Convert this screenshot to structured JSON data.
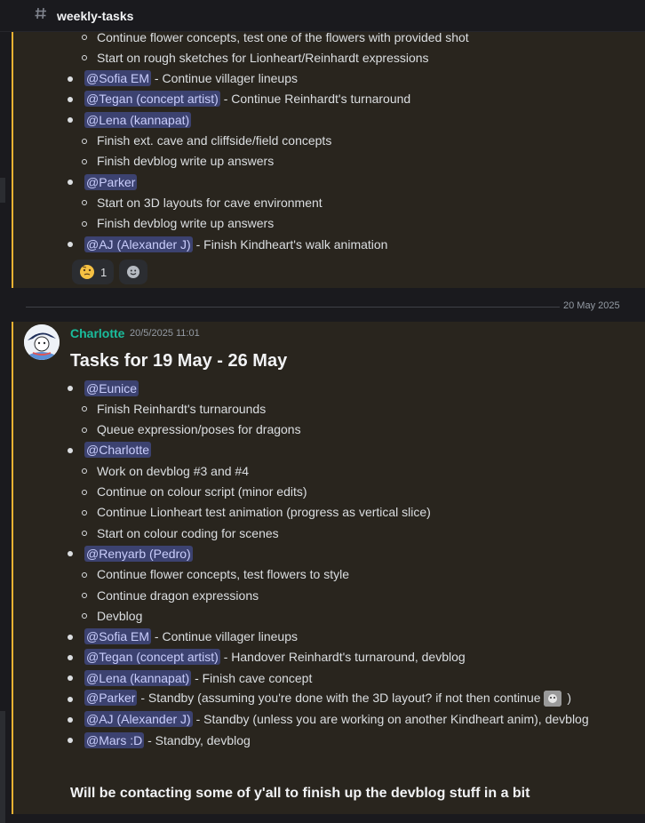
{
  "channel": {
    "name": "weekly-tasks"
  },
  "prev_message": {
    "items": [
      {
        "level": 2,
        "text": "Continue flower concepts, test one of the flowers with provided shot"
      },
      {
        "level": 2,
        "text": "Start on rough sketches for Lionheart/Reinhardt expressions"
      },
      {
        "level": 1,
        "mention": "@Sofia EM",
        "text": " - Continue villager lineups"
      },
      {
        "level": 1,
        "mention": "@Tegan (concept artist)",
        "text": " - Continue Reinhardt's turnaround"
      },
      {
        "level": 1,
        "mention": "@Lena (kannapat)",
        "text": ""
      },
      {
        "level": 2,
        "text": "Finish ext. cave and cliffside/field concepts"
      },
      {
        "level": 2,
        "text": "Finish devblog write up answers"
      },
      {
        "level": 1,
        "mention": "@Parker",
        "text": ""
      },
      {
        "level": 2,
        "text": "Start on 3D layouts for cave environment"
      },
      {
        "level": 2,
        "text": "Finish devblog write up answers"
      },
      {
        "level": 1,
        "mention": "@AJ (Alexander J)",
        "text": " - Finish Kindheart's walk animation"
      }
    ],
    "reactions": [
      {
        "emoji": "thinking-face-icon",
        "count": "1"
      },
      {
        "emoji": "add-reaction-icon",
        "count": ""
      }
    ]
  },
  "divider": {
    "date": "20 May 2025"
  },
  "message": {
    "author": "Charlotte",
    "timestamp": "20/5/2025 11:01",
    "heading": "Tasks for 19 May - 26 May",
    "items": [
      {
        "level": 1,
        "mention": "@Eunice",
        "text": ""
      },
      {
        "level": 2,
        "text": "Finish Reinhardt's turnarounds"
      },
      {
        "level": 2,
        "text": "Queue expression/poses for dragons"
      },
      {
        "level": 1,
        "mention": "@Charlotte",
        "text": ""
      },
      {
        "level": 2,
        "text": "Work on devblog #3 and #4"
      },
      {
        "level": 2,
        "text": "Continue on colour script (minor edits)"
      },
      {
        "level": 2,
        "text": "Continue Lionheart test animation (progress as vertical slice)"
      },
      {
        "level": 2,
        "text": "Start on colour coding for scenes"
      },
      {
        "level": 1,
        "mention": "@Renyarb (Pedro)",
        "text": ""
      },
      {
        "level": 2,
        "text": "Continue flower concepts, test flowers to style"
      },
      {
        "level": 2,
        "text": "Continue dragon expressions"
      },
      {
        "level": 2,
        "text": "Devblog"
      },
      {
        "level": 1,
        "mention": "@Sofia EM",
        "text": " - Continue villager lineups"
      },
      {
        "level": 1,
        "mention": "@Tegan (concept artist)",
        "text": " - Handover Reinhardt's turnaround, devblog"
      },
      {
        "level": 1,
        "mention": "@Lena (kannapat)",
        "text": " - Finish cave concept"
      },
      {
        "level": 1,
        "mention": "@Parker",
        "text": " - Standby (assuming you're done with the 3D layout? if not then continue",
        "suffix_emoji": true,
        "after": " )"
      },
      {
        "level": 1,
        "mention": "@AJ (Alexander J)",
        "text": " - Standby (unless you are working on another Kindheart anim), devblog"
      },
      {
        "level": 1,
        "mention": "@Mars :D",
        "text": " - Standby, devblog"
      }
    ],
    "footer": "Will be contacting some of y'all to finish up the devblog stuff in a bit"
  }
}
